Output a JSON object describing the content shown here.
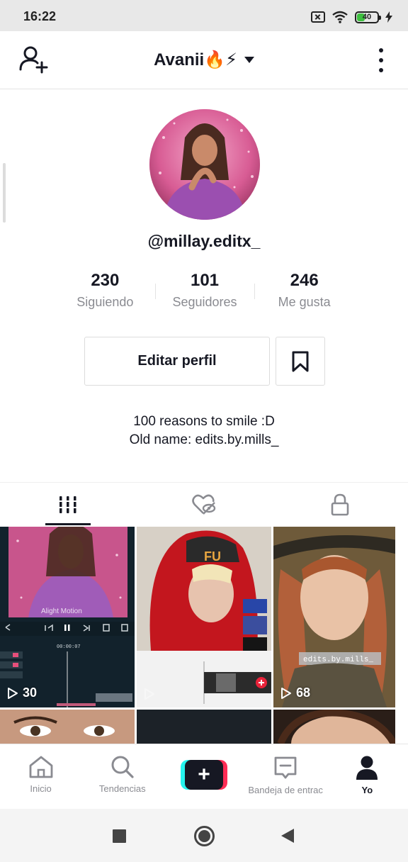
{
  "status_bar": {
    "time": "16:22",
    "battery": "40",
    "battery_level": 0.4
  },
  "header": {
    "account_name": "Avanii🔥⚡",
    "icons": [
      "add-user-icon",
      "caret-down-icon",
      "more-vertical-icon"
    ]
  },
  "profile": {
    "username": "@millay.editx_",
    "stats": [
      {
        "count": "230",
        "label": "Siguiendo"
      },
      {
        "count": "101",
        "label": "Seguidores"
      },
      {
        "count": "246",
        "label": "Me gusta"
      }
    ],
    "edit_button": "Editar perfil",
    "bio_line1": "100 reasons to smile :D",
    "bio_line2": "Old name: edits.by.mills_"
  },
  "tabs": [
    {
      "name": "videos",
      "icon": "grid-icon",
      "active": true
    },
    {
      "name": "liked",
      "icon": "hidden-heart-icon",
      "active": false
    },
    {
      "name": "private",
      "icon": "lock-icon",
      "active": false
    }
  ],
  "videos": [
    {
      "views": "30",
      "overlay_text": "Alight Motion",
      "timecode": "00:00:07"
    },
    {
      "views": "",
      "overlay_text": "FU"
    },
    {
      "views": "68",
      "overlay_text": "edits.by.mills_"
    }
  ],
  "bottom_nav": [
    {
      "label": "Inicio",
      "icon": "home-icon"
    },
    {
      "label": "Tendencias",
      "icon": "search-icon"
    },
    {
      "label": "",
      "icon": "plus-icon"
    },
    {
      "label": "Bandeja de entrac",
      "icon": "inbox-icon"
    },
    {
      "label": "Yo",
      "icon": "profile-icon",
      "active": true
    }
  ],
  "colors": {
    "text_primary": "#161823",
    "text_secondary": "#8a8b91",
    "accent_cyan": "#25f4ee",
    "accent_red": "#fe2c55"
  }
}
